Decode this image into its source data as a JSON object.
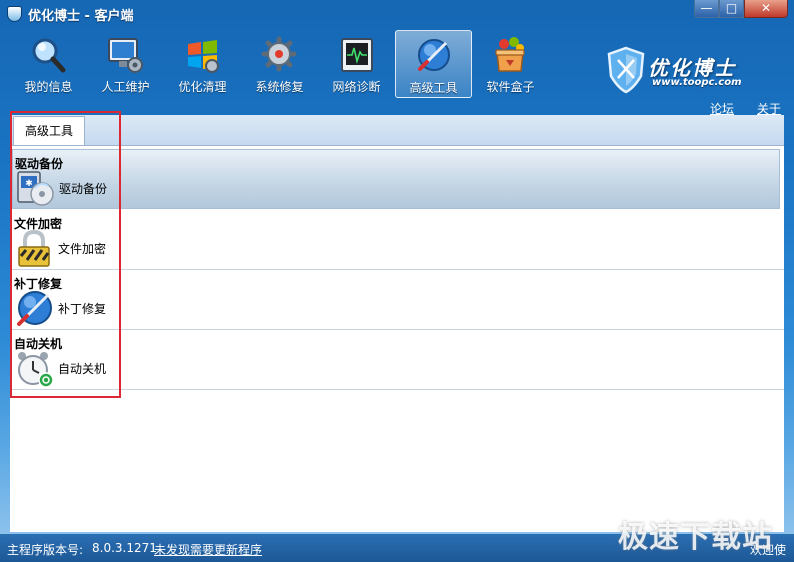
{
  "window": {
    "title": "优化博士 - 客户端",
    "min_label": "—",
    "max_label": "□",
    "close_label": "✕"
  },
  "toolbar": [
    {
      "label": "我的信息",
      "icon": "magnifier-icon"
    },
    {
      "label": "人工维护",
      "icon": "monitor-gear-icon"
    },
    {
      "label": "优化清理",
      "icon": "windows-logo-icon"
    },
    {
      "label": "系统修复",
      "icon": "gear-icon"
    },
    {
      "label": "网络诊断",
      "icon": "network-monitor-icon"
    },
    {
      "label": "高级工具",
      "icon": "compass-tool-icon",
      "active": true
    },
    {
      "label": "软件盒子",
      "icon": "software-box-icon"
    }
  ],
  "brand": {
    "name": "优化博士",
    "url": "www.toopc.com"
  },
  "links": {
    "forum": "论坛",
    "about": "关于"
  },
  "tab": {
    "label": "高级工具"
  },
  "sections": [
    {
      "title": "驱动备份",
      "item": "驱动备份",
      "icon": "driver-disc-icon"
    },
    {
      "title": "文件加密",
      "item": "文件加密",
      "icon": "padlock-icon"
    },
    {
      "title": "补丁修复",
      "item": "补丁修复",
      "icon": "patch-compass-icon"
    },
    {
      "title": "自动关机",
      "item": "自动关机",
      "icon": "alarm-clock-icon"
    }
  ],
  "status": {
    "label": "主程序版本号:",
    "version": "8.0.3.1271",
    "update_link": "未发现需要更新程序",
    "right": "欢迎使"
  },
  "watermark": "极速下载站",
  "colors": {
    "accent": "#1a75c4",
    "highlight_box": "#dc2832"
  }
}
